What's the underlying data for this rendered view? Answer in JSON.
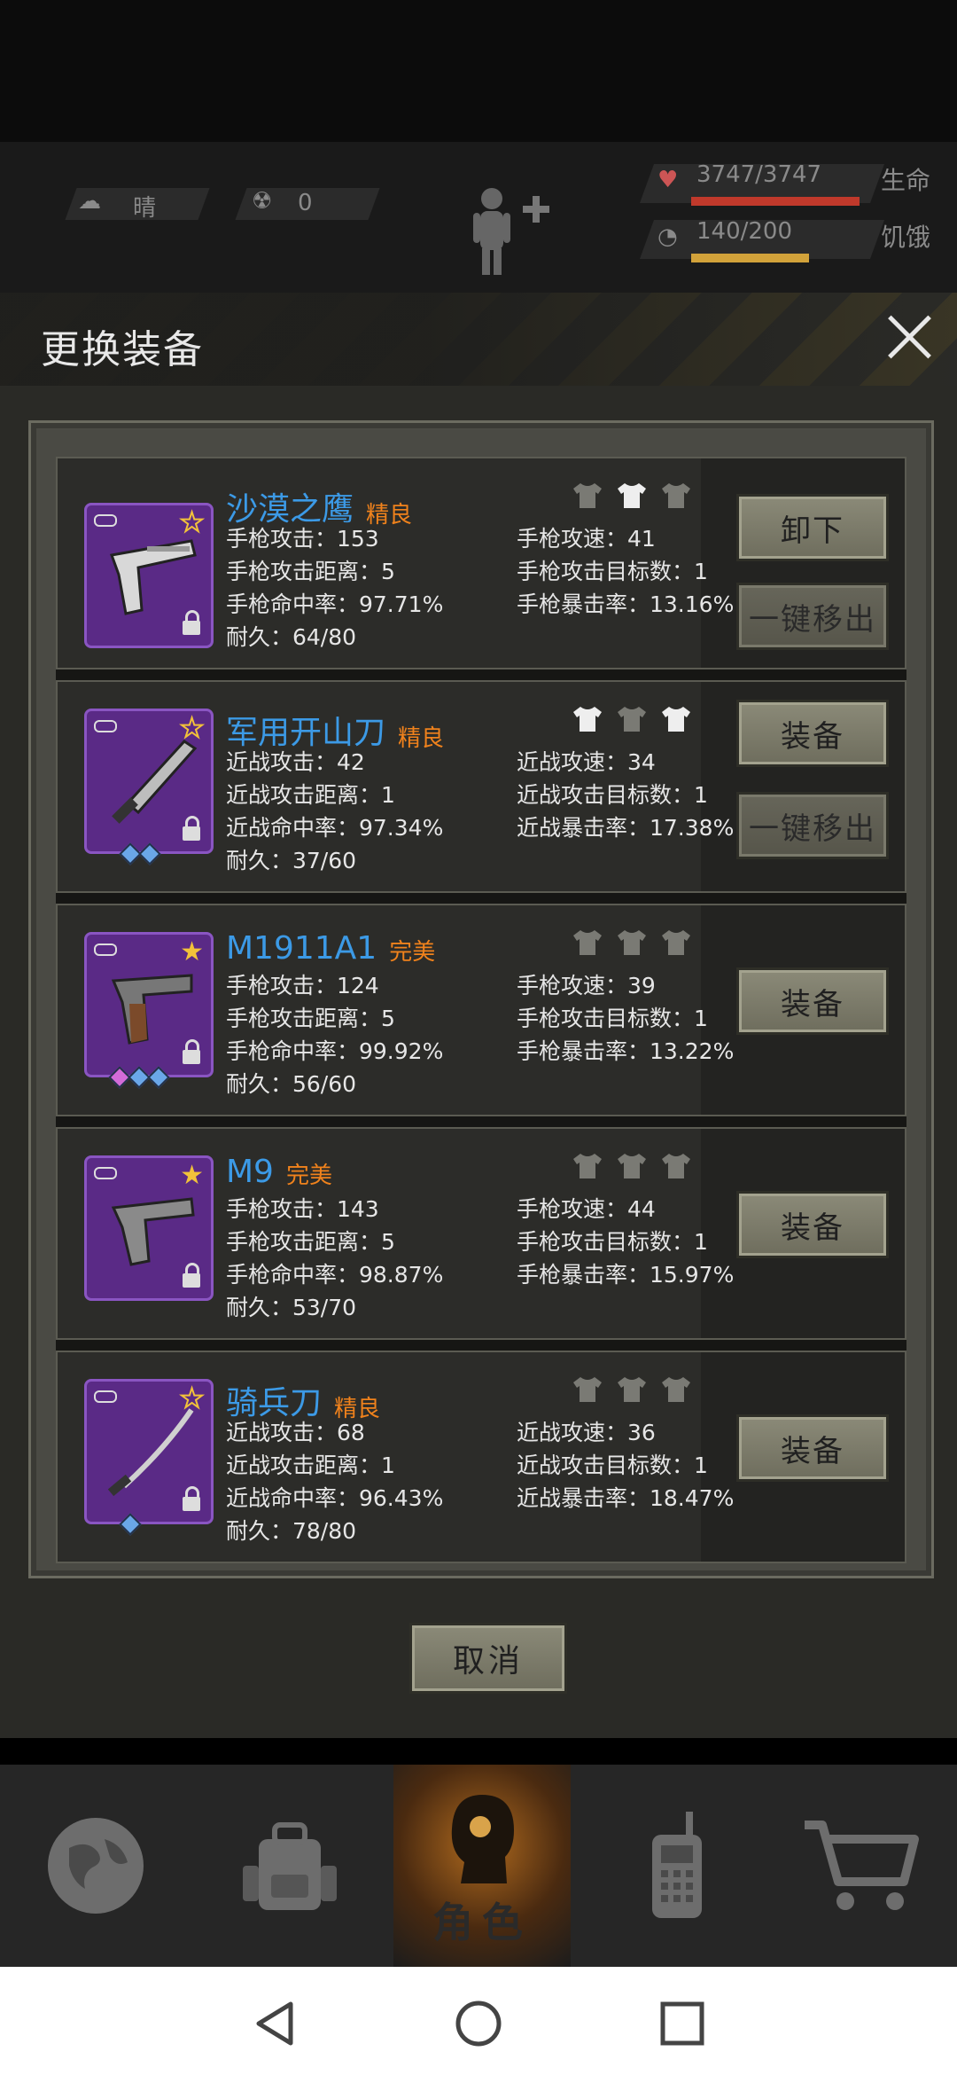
{
  "hud": {
    "weather": "晴",
    "radiation": "0",
    "hp": "3747/3747",
    "hp_label": "生命",
    "hunger": "140/200",
    "hunger_label": "饥饿",
    "hp_fraction": 1.0,
    "hunger_fraction": 0.7
  },
  "modal": {
    "title": "更换装备",
    "cancel": "取消"
  },
  "items": [
    {
      "name": "沙漠之鹰",
      "quality": "精良",
      "s1": "手枪攻击：153",
      "s2": "手枪攻击距离：5",
      "s3": "手枪命中率：97.71%",
      "s4": "耐久：64/80",
      "r1": "手枪攻速：41",
      "r2": "手枪攻击目标数：1",
      "r3": "手枪暴击率：13.16%",
      "btn1": "卸下",
      "btn2": "一键移出"
    },
    {
      "name": "军用开山刀",
      "quality": "精良",
      "s1": "近战攻击：42",
      "s2": "近战攻击距离：1",
      "s3": "近战命中率：97.34%",
      "s4": "耐久：37/60",
      "r1": "近战攻速：34",
      "r2": "近战攻击目标数：1",
      "r3": "近战暴击率：17.38%",
      "btn1": "装备",
      "btn2": "一键移出"
    },
    {
      "name": "M1911A1",
      "quality": "完美",
      "s1": "手枪攻击：124",
      "s2": "手枪攻击距离：5",
      "s3": "手枪命中率：99.92%",
      "s4": "耐久：56/60",
      "r1": "手枪攻速：39",
      "r2": "手枪攻击目标数：1",
      "r3": "手枪暴击率：13.22%",
      "btn1": "装备"
    },
    {
      "name": "M9",
      "quality": "完美",
      "s1": "手枪攻击：143",
      "s2": "手枪攻击距离：5",
      "s3": "手枪命中率：98.87%",
      "s4": "耐久：53/70",
      "r1": "手枪攻速：44",
      "r2": "手枪攻击目标数：1",
      "r3": "手枪暴击率：15.97%",
      "btn1": "装备"
    },
    {
      "name": "骑兵刀",
      "quality": "精良",
      "s1": "近战攻击：68",
      "s2": "近战攻击距离：1",
      "s3": "近战命中率：96.43%",
      "s4": "耐久：78/80",
      "r1": "近战攻速：36",
      "r2": "近战攻击目标数：1",
      "r3": "近战暴击率：18.47%",
      "btn1": "装备"
    }
  ],
  "nav": {
    "active_label": "角色",
    "icons": [
      "globe-icon",
      "backpack-icon",
      "character-icon",
      "walkie-talkie-icon",
      "shopping-cart-icon"
    ]
  },
  "colors": {
    "name_blue": "#3c9ae6",
    "quality_orange": "#f0821c",
    "thumb_purple": "#5a2a86",
    "hp_red": "#c0392b",
    "hunger_yellow": "#d2a23a"
  }
}
